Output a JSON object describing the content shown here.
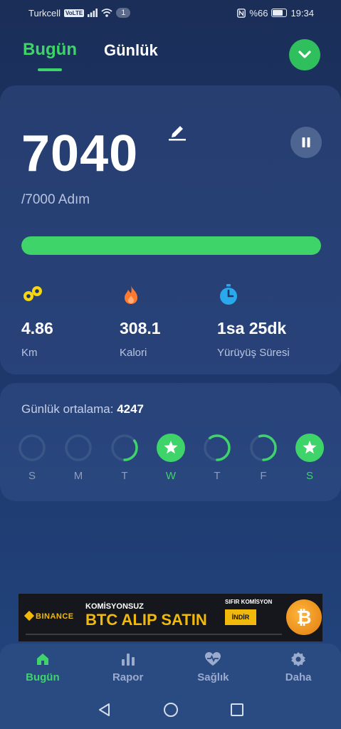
{
  "status_bar": {
    "carrier": "Turkcell",
    "volte": "VoLTE",
    "notification_count": "1",
    "battery": "%66",
    "time": "19:34"
  },
  "tabs": [
    {
      "label": "Bugün",
      "active": true
    },
    {
      "label": "Günlük",
      "active": false
    }
  ],
  "today": {
    "steps": "7040",
    "goal": "/7000 Adım",
    "progress_fraction": 1.0
  },
  "stats": [
    {
      "icon": "footprints-icon",
      "value": "4.86",
      "label": "Km"
    },
    {
      "icon": "flame-icon",
      "value": "308.1",
      "label": "Kalori"
    },
    {
      "icon": "stopwatch-icon",
      "value": "1sa 25dk",
      "label": "Yürüyüş Süresi"
    }
  ],
  "daily_average": {
    "label": "Günlük ortalama:",
    "value": "4247"
  },
  "week": [
    {
      "label": "S",
      "fraction": 0.0,
      "goal_met": false
    },
    {
      "label": "M",
      "fraction": 0.0,
      "goal_met": false
    },
    {
      "label": "T",
      "fraction": 0.35,
      "goal_met": false
    },
    {
      "label": "W",
      "fraction": 1.0,
      "goal_met": true
    },
    {
      "label": "T",
      "fraction": 0.6,
      "goal_met": false
    },
    {
      "label": "F",
      "fraction": 0.55,
      "goal_met": false
    },
    {
      "label": "S",
      "fraction": 1.0,
      "goal_met": true
    }
  ],
  "ad": {
    "brand": "BINANCE",
    "subtitle": "KOMİSYONSUZ",
    "title": "BTC ALIP SATIN",
    "badge": "SIFIR KOMİSYON",
    "button": "İNDİR",
    "coin_symbol": "₿"
  },
  "bottom_nav": [
    {
      "label": "Bugün",
      "icon": "home-icon",
      "active": true
    },
    {
      "label": "Rapor",
      "icon": "bar-chart-icon",
      "active": false
    },
    {
      "label": "Sağlık",
      "icon": "heart-pulse-icon",
      "active": false
    },
    {
      "label": "Daha",
      "icon": "gear-icon",
      "active": false
    }
  ],
  "colors": {
    "accent": "#3ed46a",
    "background": "#1d3567",
    "card": "#2b4676",
    "flame": "#ff7a2f",
    "footprints": "#f5d60f",
    "stopwatch": "#29a8ec"
  }
}
